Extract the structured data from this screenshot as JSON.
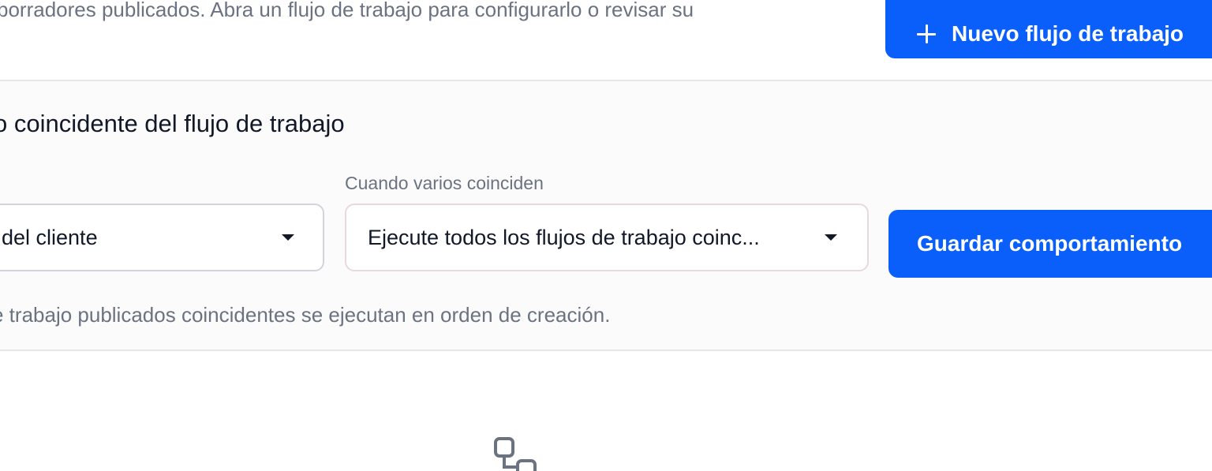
{
  "header": {
    "description": "borradores publicados. Abra un flujo de trabajo para configurarlo o revisar su",
    "new_workflow_label": "Nuevo flujo de trabajo"
  },
  "section": {
    "title": "o coincidente del flujo de trabajo",
    "first_select_value": "del cliente",
    "when_multiple_label": "Cuando varios coinciden",
    "when_multiple_value": "Ejecute todos los flujos de trabajo coinc...",
    "save_label": "Guardar comportamiento",
    "help_text": "e trabajo publicados coincidentes se ejecutan en orden de creación."
  },
  "icons": {
    "plus": "plus-icon",
    "caret": "caret-down-icon",
    "workflow": "workflow-icon"
  },
  "colors": {
    "accent": "#0a5ffb",
    "muted_text": "#6b7280",
    "border": "#e5e7eb"
  }
}
